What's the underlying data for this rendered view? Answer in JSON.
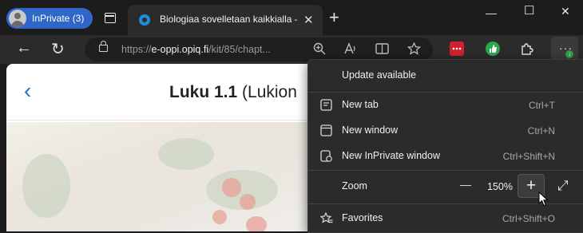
{
  "browser": {
    "inprivate_label": "InPrivate (3)",
    "tab_title": "Biologiaa sovelletaan kaikkialla –",
    "tab_close": "✕",
    "new_tab_symbol": "+",
    "window_minimize": "—",
    "window_maximize": "☐",
    "window_close": "✕"
  },
  "toolbar": {
    "back_symbol": "←",
    "refresh_symbol": "↻",
    "url_prefix": "https://",
    "url_host": "e-oppi.opiq.fi",
    "url_path": "/kit/85/chapt...",
    "menu_dots": "···",
    "update_badge": "↓"
  },
  "page": {
    "back_symbol": "‹",
    "heading_bold": "Luku 1.1",
    "heading_rest": " (Lukion"
  },
  "menu": {
    "update": "Update available",
    "new_tab": {
      "label": "New tab",
      "shortcut": "Ctrl+T"
    },
    "new_window": {
      "label": "New window",
      "shortcut": "Ctrl+N"
    },
    "new_inprivate": {
      "label": "New InPrivate window",
      "shortcut": "Ctrl+Shift+N"
    },
    "zoom": {
      "label": "Zoom",
      "minus": "—",
      "value": "150%",
      "plus": "+",
      "fullscreen": "⤢"
    },
    "favorites": {
      "label": "Favorites",
      "shortcut": "Ctrl+Shift+O"
    }
  }
}
